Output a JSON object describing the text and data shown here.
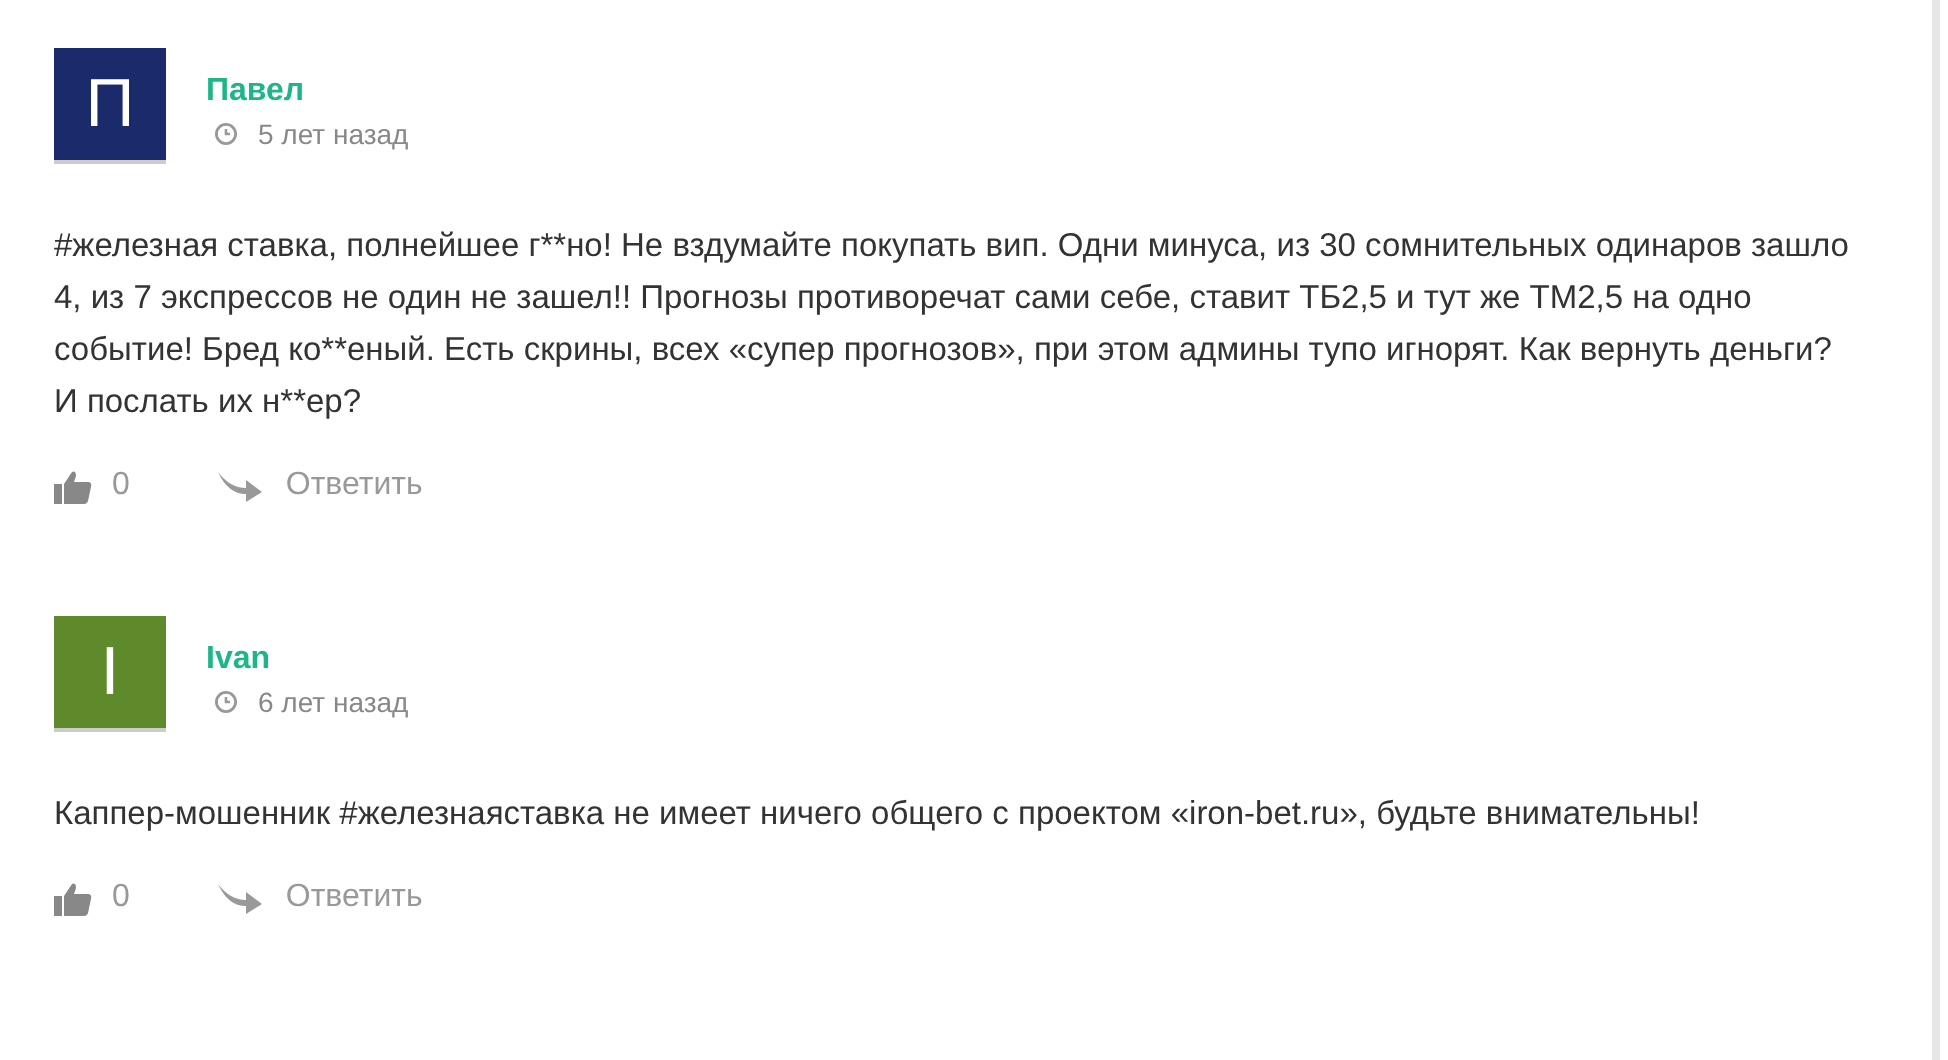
{
  "comments": [
    {
      "avatar": {
        "letter": "П",
        "color": "#1b2a6b"
      },
      "author": "Павел",
      "time": "5 лет назад",
      "text": "#железная ставка, полнейшее г**но! Не вздумайте покупать вип. Одни минуса, из 30 сомнительных одинаров зашло 4, из 7 экспрессов не один не зашел!! Прогнозы противоречат сами себе, ставит ТБ2,5 и тут же ТМ2,5 на одно событие! Бред ко**еный. Есть скрины, всех «супер прогнозов», при этом админы тупо игнорят. Как вернуть деньги? И послать их н**ер?",
      "likes": "0",
      "reply": "Ответить"
    },
    {
      "avatar": {
        "letter": "I",
        "color": "#5e8a2b"
      },
      "author": "Ivan",
      "time": "6 лет назад",
      "text": "Каппер-мошенник #железнаяставка не имеет ничего общего с проектом «iron-bet.ru», будьте внимательны!",
      "likes": "0",
      "reply": "Ответить"
    }
  ]
}
